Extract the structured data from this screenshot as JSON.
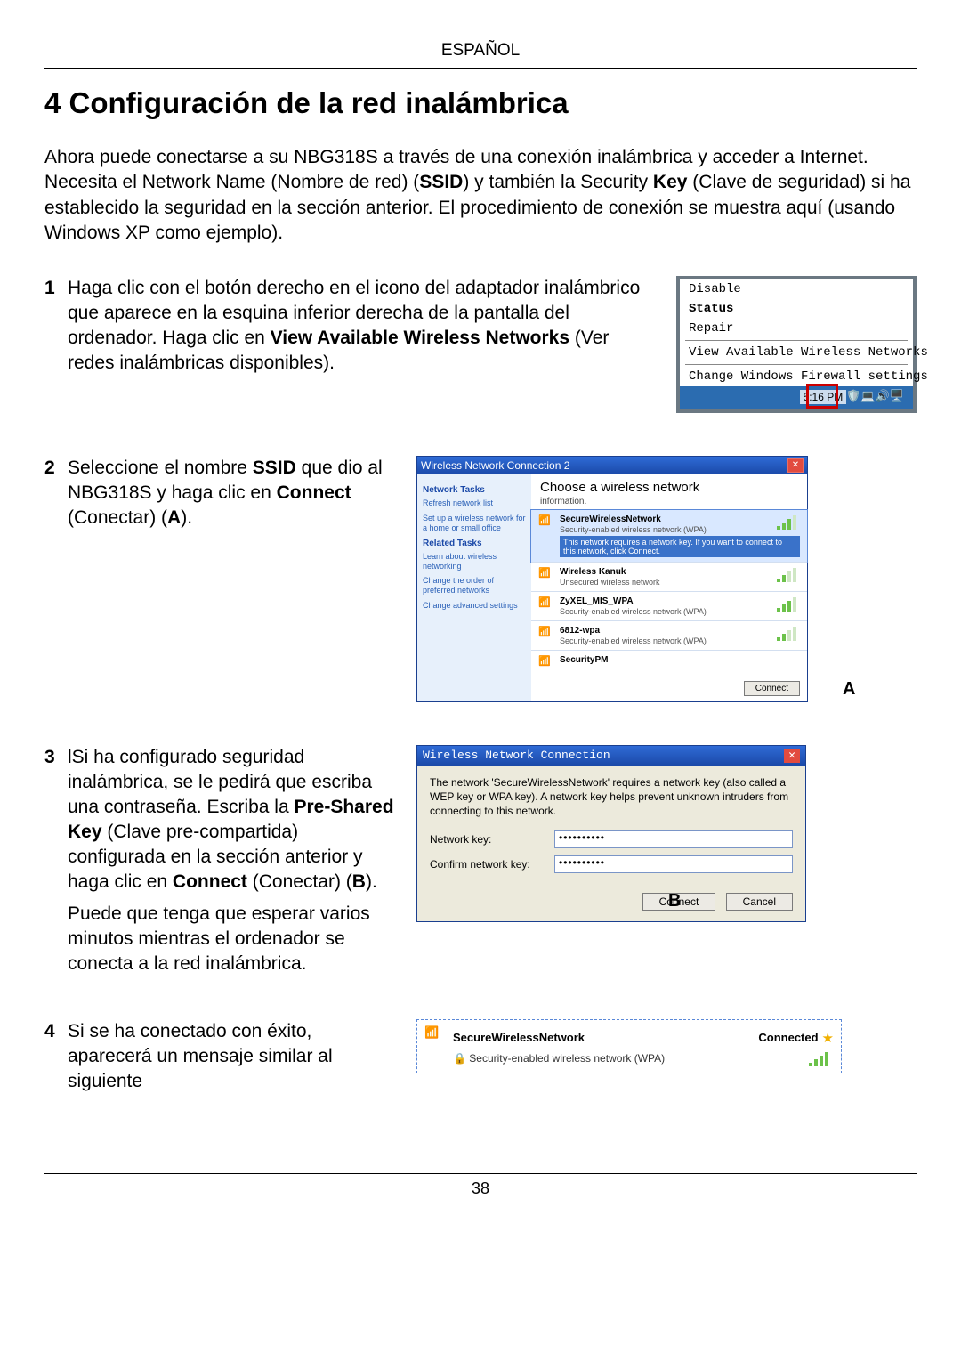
{
  "lang_header": "ESPAÑOL",
  "section_title": "4 Configuración de la red inalámbrica",
  "intro_parts": {
    "t1": "Ahora puede conectarse a su NBG318S a través de una conexión inalámbrica y acceder a Internet. Necesita el Network Name (Nombre de red) (",
    "b1": "SSID",
    "t2": ") y también la Security ",
    "b2": "Key",
    "t3": " (Clave de seguridad) si ha establecido la seguridad en la sección anterior. El procedimiento de conexión se muestra aquí (usando Windows XP como ejemplo)."
  },
  "steps": {
    "s1": {
      "num": "1",
      "t1": "Haga clic con el botón derecho en el icono del adaptador inalámbrico que aparece en la esquina inferior derecha de la pantalla del ordenador. Haga clic en ",
      "b1": "View Available Wireless Networks",
      "t2": " (Ver redes inalámbricas disponibles)."
    },
    "s2": {
      "num": "2",
      "t1": "Seleccione el nombre ",
      "b1": "SSID",
      "t2": " que dio al NBG318S y haga clic en ",
      "b2": "Connect",
      "t3": " (Conectar) (",
      "b3": "A",
      "t4": ")."
    },
    "s3": {
      "num": "3",
      "t1": "lSi ha configurado seguridad inalámbrica, se le pedirá que escriba una contraseña. Escriba la ",
      "b1": "Pre-Shared Key",
      "t2": " (Clave pre-compartida) configurada en la sección anterior y haga clic en ",
      "b2": "Connect",
      "t3": " (Conectar) (",
      "b3": "B",
      "t4": ").",
      "p2": "Puede que tenga que esperar varios minutos mientras el ordenador se conecta a la red inalámbrica."
    },
    "s4": {
      "num": "4",
      "t1": "Si se ha conectado con éxito, aparecerá un mensaje similar al siguiente"
    }
  },
  "context_menu": {
    "disable": "Disable",
    "status": "Status",
    "repair": "Repair",
    "view": "View Available Wireless Networks",
    "firewall": "Change Windows Firewall settings",
    "time": "5:16 PM"
  },
  "wnc": {
    "title": "Wireless Network Connection 2",
    "side_tasks_h": "Network Tasks",
    "side_refresh": "Refresh network list",
    "side_setup": "Set up a wireless network for a home or small office",
    "side_related_h": "Related Tasks",
    "side_learn": "Learn about wireless networking",
    "side_order": "Change the order of preferred networks",
    "side_adv": "Change advanced settings",
    "main_h": "Choose a wireless network",
    "main_info": "information.",
    "nets": [
      {
        "name": "SecureWirelessNetwork",
        "desc": "Security-enabled wireless network (WPA)",
        "msg": "This network requires a network key. If you want to connect to this network, click Connect."
      },
      {
        "name": "Wireless Kanuk",
        "desc": "Unsecured wireless network",
        "msg": ""
      },
      {
        "name": "ZyXEL_MIS_WPA",
        "desc": "Security-enabled wireless network (WPA)",
        "msg": ""
      },
      {
        "name": "6812-wpa",
        "desc": "Security-enabled wireless network (WPA)",
        "msg": ""
      },
      {
        "name": "SecurityPM",
        "desc": "",
        "msg": ""
      }
    ],
    "connect_btn": "Connect",
    "label_a": "A"
  },
  "dlgB": {
    "title": "Wireless Network Connection",
    "msg": "The network 'SecureWirelessNetwork' requires a network key (also called a WEP key or WPA key). A network key helps prevent unknown intruders from connecting to this network.",
    "nk_label": "Network key:",
    "ck_label": "Confirm network key:",
    "nk_val": "••••••••••",
    "ck_val": "••••••••••",
    "connect": "Connect",
    "cancel": "Cancel",
    "label_b": "B"
  },
  "connbox": {
    "name": "SecureWirelessNetwork",
    "status": "Connected",
    "desc": "Security-enabled wireless network (WPA)"
  },
  "page_number": "38"
}
